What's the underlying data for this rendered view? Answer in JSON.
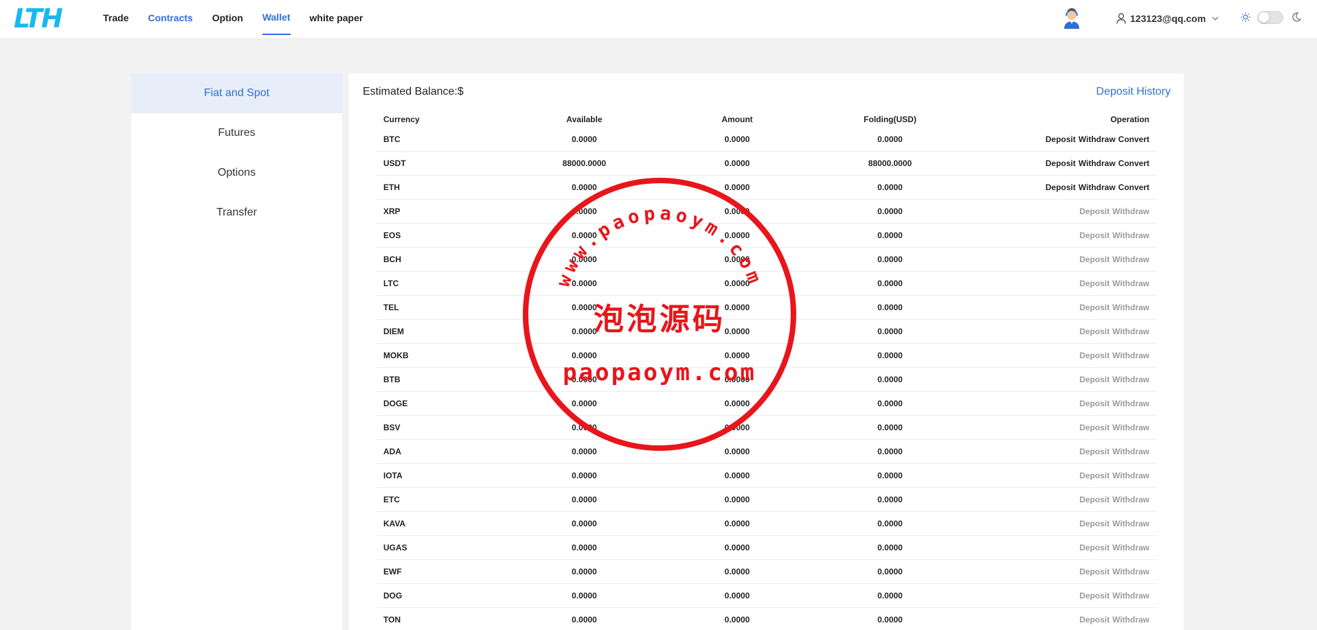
{
  "header": {
    "logo_text": "LTH",
    "nav": [
      {
        "label": "Trade"
      },
      {
        "label": "Contracts"
      },
      {
        "label": "Option"
      },
      {
        "label": "Wallet"
      },
      {
        "label": "white paper"
      }
    ],
    "user_email": "123123@qq.com"
  },
  "sidebar": {
    "items": [
      {
        "label": "Fiat and Spot"
      },
      {
        "label": "Futures"
      },
      {
        "label": "Options"
      },
      {
        "label": "Transfer"
      }
    ]
  },
  "main": {
    "estimated_balance": "Estimated Balance:$",
    "deposit_history": "Deposit History",
    "columns": [
      "Currency",
      "Available",
      "Amount",
      "Folding(USD)",
      "Operation"
    ],
    "rows": [
      {
        "currency": "BTC",
        "available": "0.0000",
        "amount": "0.0000",
        "folding": "0.0000",
        "ops": [
          "Deposit",
          "Withdraw",
          "Convert"
        ],
        "muted": false
      },
      {
        "currency": "USDT",
        "available": "88000.0000",
        "amount": "0.0000",
        "folding": "88000.0000",
        "ops": [
          "Deposit",
          "Withdraw",
          "Convert"
        ],
        "muted": false
      },
      {
        "currency": "ETH",
        "available": "0.0000",
        "amount": "0.0000",
        "folding": "0.0000",
        "ops": [
          "Deposit",
          "Withdraw",
          "Convert"
        ],
        "muted": false
      },
      {
        "currency": "XRP",
        "available": "0.0000",
        "amount": "0.0000",
        "folding": "0.0000",
        "ops": [
          "Deposit",
          "Withdraw"
        ],
        "muted": true
      },
      {
        "currency": "EOS",
        "available": "0.0000",
        "amount": "0.0000",
        "folding": "0.0000",
        "ops": [
          "Deposit",
          "Withdraw"
        ],
        "muted": true
      },
      {
        "currency": "BCH",
        "available": "0.0000",
        "amount": "0.0000",
        "folding": "0.0000",
        "ops": [
          "Deposit",
          "Withdraw"
        ],
        "muted": true
      },
      {
        "currency": "LTC",
        "available": "0.0000",
        "amount": "0.0000",
        "folding": "0.0000",
        "ops": [
          "Deposit",
          "Withdraw"
        ],
        "muted": true
      },
      {
        "currency": "TEL",
        "available": "0.0000",
        "amount": "0.0000",
        "folding": "0.0000",
        "ops": [
          "Deposit",
          "Withdraw"
        ],
        "muted": true
      },
      {
        "currency": "DIEM",
        "available": "0.0000",
        "amount": "0.0000",
        "folding": "0.0000",
        "ops": [
          "Deposit",
          "Withdraw"
        ],
        "muted": true
      },
      {
        "currency": "MOKB",
        "available": "0.0000",
        "amount": "0.0000",
        "folding": "0.0000",
        "ops": [
          "Deposit",
          "Withdraw"
        ],
        "muted": true
      },
      {
        "currency": "BTB",
        "available": "0.0000",
        "amount": "0.0000",
        "folding": "0.0000",
        "ops": [
          "Deposit",
          "Withdraw"
        ],
        "muted": true
      },
      {
        "currency": "DOGE",
        "available": "0.0000",
        "amount": "0.0000",
        "folding": "0.0000",
        "ops": [
          "Deposit",
          "Withdraw"
        ],
        "muted": true
      },
      {
        "currency": "BSV",
        "available": "0.0000",
        "amount": "0.0000",
        "folding": "0.0000",
        "ops": [
          "Deposit",
          "Withdraw"
        ],
        "muted": true
      },
      {
        "currency": "ADA",
        "available": "0.0000",
        "amount": "0.0000",
        "folding": "0.0000",
        "ops": [
          "Deposit",
          "Withdraw"
        ],
        "muted": true
      },
      {
        "currency": "IOTA",
        "available": "0.0000",
        "amount": "0.0000",
        "folding": "0.0000",
        "ops": [
          "Deposit",
          "Withdraw"
        ],
        "muted": true
      },
      {
        "currency": "ETC",
        "available": "0.0000",
        "amount": "0.0000",
        "folding": "0.0000",
        "ops": [
          "Deposit",
          "Withdraw"
        ],
        "muted": true
      },
      {
        "currency": "KAVA",
        "available": "0.0000",
        "amount": "0.0000",
        "folding": "0.0000",
        "ops": [
          "Deposit",
          "Withdraw"
        ],
        "muted": true
      },
      {
        "currency": "UGAS",
        "available": "0.0000",
        "amount": "0.0000",
        "folding": "0.0000",
        "ops": [
          "Deposit",
          "Withdraw"
        ],
        "muted": true
      },
      {
        "currency": "EWF",
        "available": "0.0000",
        "amount": "0.0000",
        "folding": "0.0000",
        "ops": [
          "Deposit",
          "Withdraw"
        ],
        "muted": true
      },
      {
        "currency": "DOG",
        "available": "0.0000",
        "amount": "0.0000",
        "folding": "0.0000",
        "ops": [
          "Deposit",
          "Withdraw"
        ],
        "muted": true
      },
      {
        "currency": "TON",
        "available": "0.0000",
        "amount": "0.0000",
        "folding": "0.0000",
        "ops": [
          "Deposit",
          "Withdraw"
        ],
        "muted": true
      }
    ]
  },
  "watermark": {
    "arc_text": "www.paopaoym.com",
    "center_text": "泡泡源码",
    "bottom_text": "paopaoym.com",
    "color": "#e8151b"
  },
  "colors": {
    "accent": "#2f6fd6",
    "background": "#f2f2f2",
    "muted": "#9a9a9a"
  }
}
